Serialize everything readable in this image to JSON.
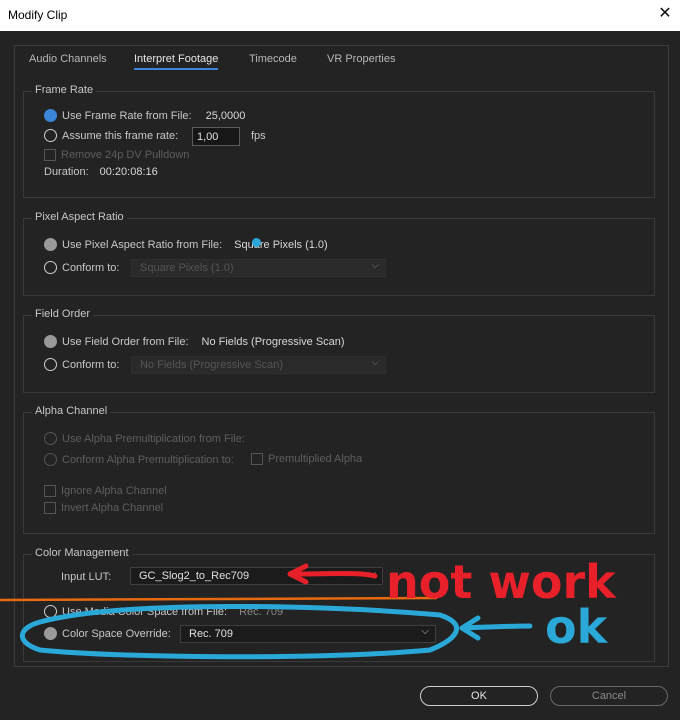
{
  "window": {
    "title": "Modify Clip"
  },
  "tabs": [
    {
      "label": "Audio Channels"
    },
    {
      "label": "Interpret Footage"
    },
    {
      "label": "Timecode"
    },
    {
      "label": "VR Properties"
    }
  ],
  "frame_rate": {
    "legend": "Frame Rate",
    "use_from_file_label": "Use Frame Rate from File:",
    "use_from_file_value": "25,0000",
    "assume_label": "Assume this frame rate:",
    "assume_value": "1,00",
    "assume_unit": "fps",
    "pulldown_label": "Remove 24p DV Pulldown",
    "duration_label": "Duration:",
    "duration_value": "00:20:08:16"
  },
  "pixel_aspect": {
    "legend": "Pixel Aspect Ratio",
    "use_from_file_label": "Use Pixel Aspect Ratio from File:",
    "use_from_file_value": "Square Pixels (1.0)",
    "conform_label": "Conform to:",
    "conform_value": "Square Pixels (1.0)"
  },
  "field_order": {
    "legend": "Field Order",
    "use_from_file_label": "Use Field Order from File:",
    "use_from_file_value": "No Fields (Progressive Scan)",
    "conform_label": "Conform to:",
    "conform_value": "No Fields (Progressive Scan)"
  },
  "alpha": {
    "legend": "Alpha Channel",
    "use_premult_label": "Use Alpha Premultiplication from File:",
    "conform_premult_label": "Conform Alpha Premultiplication to:",
    "premultiplied_label": "Premultiplied Alpha",
    "ignore_label": "Ignore Alpha Channel",
    "invert_label": "Invert Alpha Channel"
  },
  "color": {
    "legend": "Color Management",
    "input_lut_label": "Input LUT:",
    "input_lut_value": "GC_Slog2_to_Rec709",
    "media_space_label": "Use Media Color Space from File:",
    "media_space_value": "Rec. 709",
    "override_label": "Color Space Override:",
    "override_value": "Rec. 709"
  },
  "annotations": {
    "not_work": "not work",
    "ok": "ok"
  },
  "buttons": {
    "ok": "OK",
    "cancel": "Cancel"
  },
  "colors": {
    "accent": "#3a86d8",
    "annotation_red": "#e8202a",
    "annotation_blue": "#2aa8d8",
    "annotation_orange": "#e86a10"
  }
}
